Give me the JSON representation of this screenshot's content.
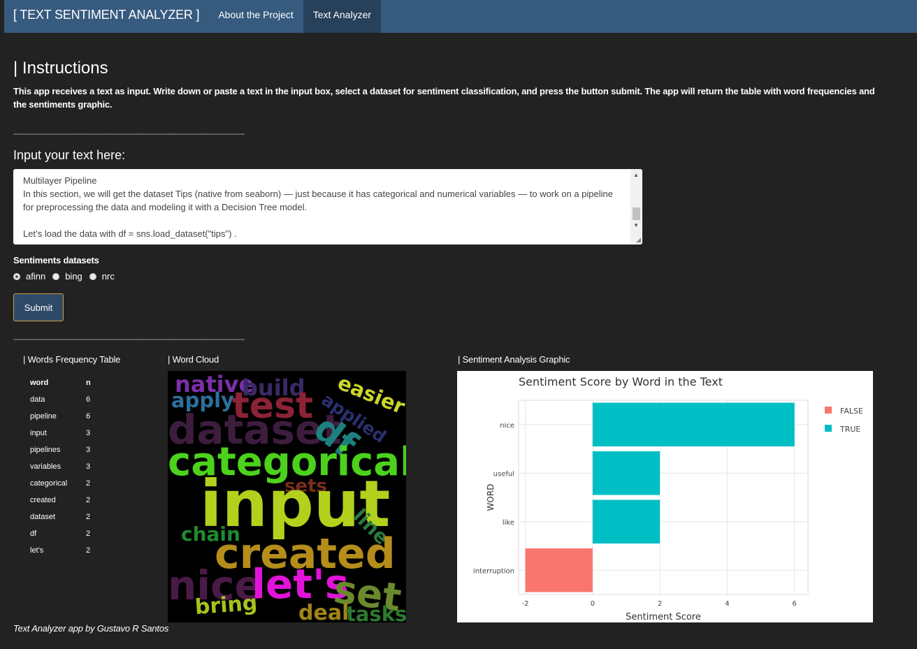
{
  "navbar": {
    "brand": "[ TEXT SENTIMENT ANALYZER ]",
    "items": [
      {
        "label": "About the Project"
      },
      {
        "label": "Text Analyzer"
      }
    ]
  },
  "instructions": {
    "title": "| Instructions",
    "text": "This app receives a text as input. Write down or paste a text in the input box, select a dataset for sentiment classification, and press the button submit. The app will return the table with word frequencies and the sentiments graphic."
  },
  "divider": "------------------------------------------------------------------------------------------------------------",
  "input": {
    "title": "Input your text here:",
    "value": "Multilayer Pipeline\nIn this section, we will get the dataset Tips (native from seaborn) — just because it has categorical and numerical variables — to work on a pipeline for preprocessing the data and modeling it with a Decision Tree model.\n\nLet’s load the data with df = sns.load_dataset(\"tips\") ."
  },
  "sentiments": {
    "label": "Sentiments datasets",
    "options": [
      "afinn",
      "bing",
      "nrc"
    ],
    "selected": "afinn"
  },
  "submit_label": "Submit",
  "freq_table": {
    "title": "| Words Frequency Table",
    "headers": [
      "word",
      "n"
    ],
    "rows": [
      [
        "data",
        "6"
      ],
      [
        "pipeline",
        "6"
      ],
      [
        "input",
        "3"
      ],
      [
        "pipelines",
        "3"
      ],
      [
        "variables",
        "3"
      ],
      [
        "categorical",
        "2"
      ],
      [
        "created",
        "2"
      ],
      [
        "dataset",
        "2"
      ],
      [
        "df",
        "2"
      ],
      [
        "let's",
        "2"
      ]
    ]
  },
  "wordcloud": {
    "title": "| Word Cloud",
    "words": [
      {
        "text": "native",
        "color": "#7b2fa8"
      },
      {
        "text": "build",
        "color": "#3a2a66"
      },
      {
        "text": "easier",
        "color": "#c9d62a"
      },
      {
        "text": "applied",
        "color": "#2b2f6e"
      },
      {
        "text": "apply",
        "color": "#2d6f9c"
      },
      {
        "text": "test",
        "color": "#8c2236"
      },
      {
        "text": "dataset",
        "color": "#3d1d3d"
      },
      {
        "text": "df",
        "color": "#1c8080"
      },
      {
        "text": "categorical",
        "color": "#4cd21c"
      },
      {
        "text": "sets",
        "color": "#7a2e1a"
      },
      {
        "text": "input",
        "color": "#b3d11c"
      },
      {
        "text": "line",
        "color": "#2b7a3e"
      },
      {
        "text": "chain",
        "color": "#1f8a2e"
      },
      {
        "text": "created",
        "color": "#b58d1a"
      },
      {
        "text": "nice",
        "color": "#4a1a46"
      },
      {
        "text": "let's",
        "color": "#e213d8"
      },
      {
        "text": "set",
        "color": "#6b8a2e"
      },
      {
        "text": "bring",
        "color": "#a9c21c"
      },
      {
        "text": "deal",
        "color": "#a08416"
      },
      {
        "text": "tasks",
        "color": "#2b7a2e"
      }
    ]
  },
  "chart": {
    "section_title": "| Sentiment Analysis Graphic"
  },
  "chart_data": {
    "type": "bar",
    "orientation": "horizontal",
    "title": "Sentiment Score by Word in the Text",
    "xlabel": "Sentiment Score",
    "ylabel": "WORD",
    "categories": [
      "nice",
      "useful",
      "like",
      "interruption"
    ],
    "values": [
      6,
      2,
      2,
      -2
    ],
    "positive": [
      true,
      true,
      true,
      false
    ],
    "xlim": [
      -2.2,
      6.4
    ],
    "xticks": [
      "-2",
      "0",
      "2",
      "4",
      "6"
    ],
    "legend": [
      {
        "name": "FALSE",
        "color": "#f8766d"
      },
      {
        "name": "TRUE",
        "color": "#00bfc4"
      }
    ],
    "legend_position": "right",
    "grid": true
  },
  "footer": "Text Analyzer app by Gustavo R Santos"
}
